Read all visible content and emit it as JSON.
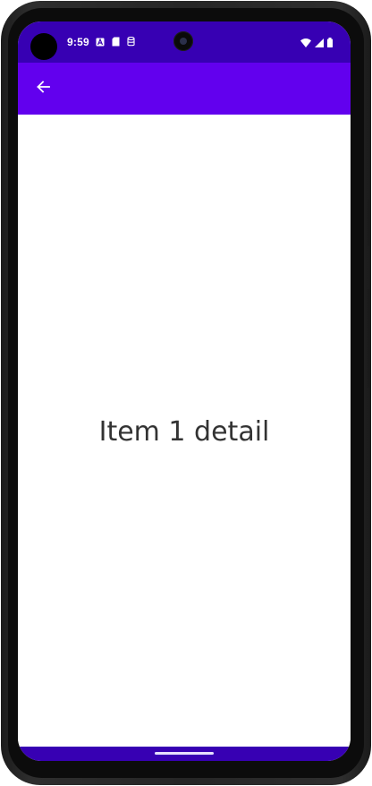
{
  "status_bar": {
    "time": "9:59",
    "notification_icons": [
      "accessibility-a-icon",
      "sd-card-icon",
      "database-icon"
    ],
    "system_icons": [
      "wifi-icon",
      "cell-signal-icon",
      "battery-icon"
    ],
    "background_color": "#3700b3"
  },
  "app_bar": {
    "navigation_icon": "arrow-back-icon",
    "background_color": "#6200ee"
  },
  "content": {
    "detail_text": "Item 1 detail"
  },
  "navigation_bar": {
    "gesture_handle": "home-gesture-handle",
    "background_color": "#3700b3"
  }
}
